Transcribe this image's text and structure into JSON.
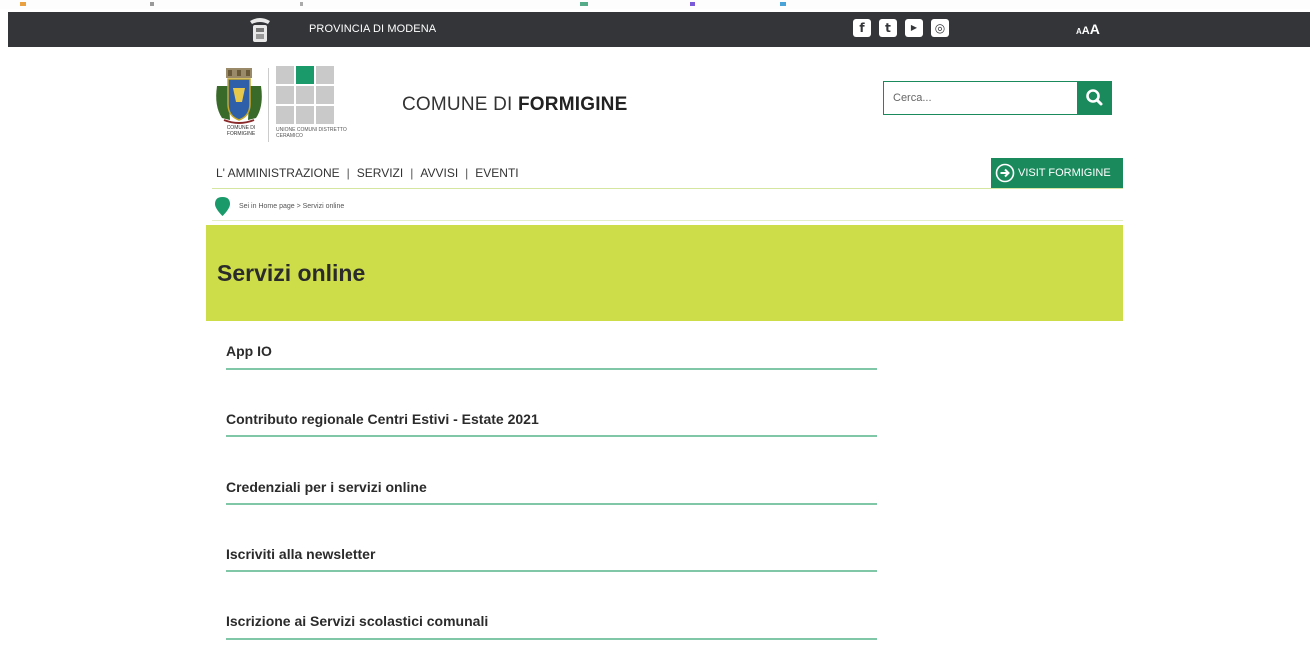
{
  "topbar": {
    "province_label": "PROVINCIA DI MODENA",
    "social": [
      {
        "icon": "facebook-icon",
        "glyph": "f"
      },
      {
        "icon": "twitter-icon",
        "glyph": "t"
      },
      {
        "icon": "youtube-icon",
        "glyph": "▶"
      },
      {
        "icon": "instagram-icon",
        "glyph": "◎"
      }
    ],
    "font_size": {
      "small": "A",
      "medium": "A",
      "large": "A"
    }
  },
  "header": {
    "comune_logo_text": "COMUNE DI FORMIGINE",
    "unione_logo_text": "UNIONE COMUNI DISTRETTO CERAMICO",
    "title_prefix": "COMUNE DI ",
    "title_bold": "FORMIGINE",
    "search_placeholder": "Cerca..."
  },
  "nav": {
    "items": [
      "L' AMMINISTRAZIONE",
      "SERVIZI",
      "AVVISI",
      "EVENTI"
    ],
    "separator": "|",
    "visit_label": "VISIT FORMIGINE"
  },
  "breadcrumb": "Sei in Home page > Servizi online",
  "hero": {
    "title": "Servizi online"
  },
  "services": [
    "App IO",
    "Contributo regionale Centri Estivi - Estate 2021",
    "Credenziali per i servizi online",
    "Iscriviti alla newsletter",
    "Iscrizione ai Servizi scolastici comunali"
  ],
  "colors": {
    "topbar": "#333539",
    "brand_green": "#1a8a5c",
    "hero_lime": "#cddd4a",
    "item_underline": "#7fc7a6"
  }
}
